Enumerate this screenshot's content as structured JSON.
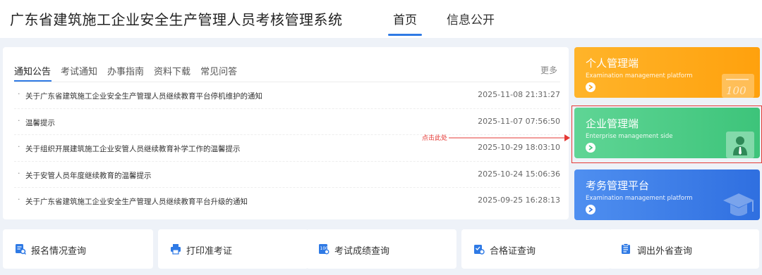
{
  "header": {
    "site_title": "广东省建筑施工企业安全生产管理人员考核管理系统",
    "nav": [
      {
        "label": "首页",
        "active": true
      },
      {
        "label": "信息公开",
        "active": false
      }
    ]
  },
  "notice_panel": {
    "tabs": [
      {
        "label": "通知公告",
        "active": true
      },
      {
        "label": "考试通知",
        "active": false
      },
      {
        "label": "办事指南",
        "active": false
      },
      {
        "label": "资料下载",
        "active": false
      },
      {
        "label": "常见问答",
        "active": false
      }
    ],
    "more_label": "更多",
    "items": [
      {
        "title": "关于广东省建筑施工企业安全生产管理人员继续教育平台停机维护的通知",
        "date": "2025-11-08 21:31:27"
      },
      {
        "title": "温馨提示",
        "date": "2025-11-07 07:56:50"
      },
      {
        "title": "关于组织开展建筑施工企业安管人员继续教育补学工作的温馨提示",
        "date": "2025-10-29 18:03:10"
      },
      {
        "title": "关于安管人员年度继续教育的温馨提示",
        "date": "2025-10-24 15:06:36"
      },
      {
        "title": "关于广东省建筑施工企业安全生产管理人员继续教育平台升级的通知",
        "date": "2025-09-25 16:28:13"
      }
    ]
  },
  "annotation": {
    "click_hint": "点击此处",
    "color": "#e53935"
  },
  "cards": {
    "personal": {
      "title": "个人管理端",
      "subtitle": "Examination management platform",
      "color": "#ffa10d"
    },
    "enterprise": {
      "title": "企业管理端",
      "subtitle": "Enterprise management side",
      "color": "#3dc47a"
    },
    "exam": {
      "title": "考务管理平台",
      "subtitle": "Examination management platform",
      "color": "#2f6fe0"
    }
  },
  "quick_links": [
    {
      "label": "报名情况查询",
      "icon": "registration-query-icon"
    },
    {
      "label": "打印准考证",
      "icon": "printer-icon"
    },
    {
      "label": "考试成绩查询",
      "icon": "score-query-icon"
    },
    {
      "label": "合格证查询",
      "icon": "certificate-query-icon"
    },
    {
      "label": "调出外省查询",
      "icon": "transfer-query-icon"
    }
  ],
  "theme": {
    "accent": "#2f7ae5"
  }
}
